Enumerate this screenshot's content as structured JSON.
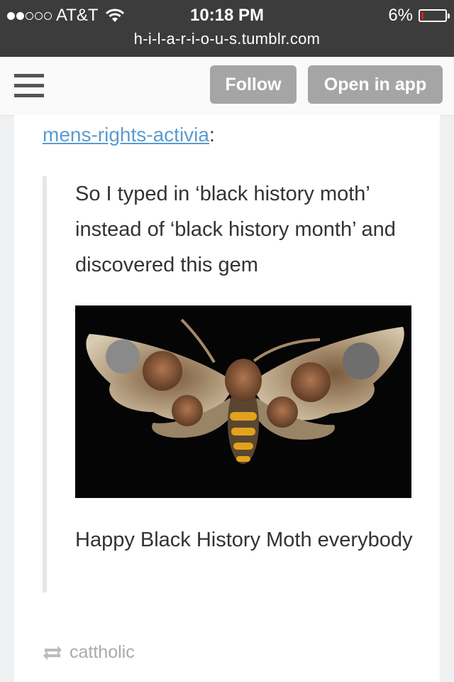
{
  "status_bar": {
    "carrier": "AT&T",
    "time": "10:18 PM",
    "battery_percent": "6%",
    "url": "h-i-l-a-r-i-o-u-s.tumblr.com"
  },
  "header": {
    "follow_label": "Follow",
    "open_in_app_label": "Open in app"
  },
  "post": {
    "source_user": "mens-rights-activia",
    "source_colon": ":",
    "quote_text": "So I typed in ‘black history moth’ instead of ‘black history month’ and discovered this gem",
    "caption": "Happy Black History Moth everybody",
    "reblogged_by": "cattholic"
  },
  "colors": {
    "link": "#5a9bd0",
    "button": "#a5a5a5",
    "status_bar": "#3c3c3c"
  },
  "icons": [
    "wifi-icon",
    "battery-icon",
    "menu-icon",
    "reblog-icon"
  ]
}
